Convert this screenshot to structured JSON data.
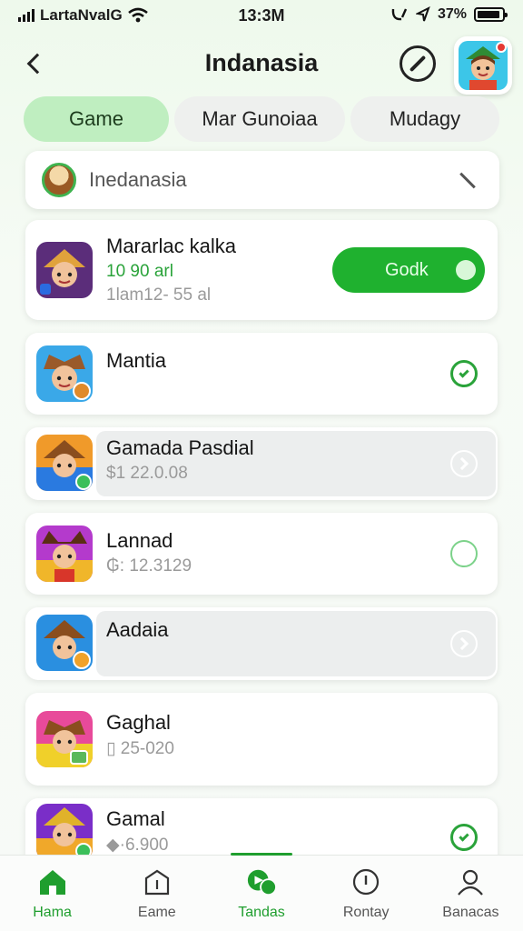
{
  "status_bar": {
    "carrier": "LartaNvalG",
    "time": "13:3M",
    "battery": "37%"
  },
  "header": {
    "title": "Indanasia"
  },
  "tabs": [
    {
      "label": "Game",
      "active": true
    },
    {
      "label": "Mar Gunoiaa",
      "active": false
    },
    {
      "label": "Mudagy",
      "active": false
    }
  ],
  "search": {
    "value": "Inedanasia"
  },
  "items": [
    {
      "name": "Mararlac kalka",
      "sub1": "10 90 arl",
      "sub2": "1lam12- 55 al",
      "toggle_label": "Godk"
    },
    {
      "name": "Mantia"
    },
    {
      "name": "Gamada Pasdial",
      "sub": "$1 22.0.08"
    },
    {
      "name": "Lannad",
      "sub": "12.3129",
      "sub_prefix": "₲:"
    },
    {
      "name": "Aadaia"
    },
    {
      "name": "Gaghal",
      "sub": "25-020"
    },
    {
      "name": "Gamal",
      "sub": "·6.900"
    }
  ],
  "bottom_nav": [
    {
      "label": "Hama",
      "icon": "home-icon",
      "active": true
    },
    {
      "label": "Eame",
      "icon": "box-icon",
      "active": false
    },
    {
      "label": "Tandas",
      "icon": "game-icon",
      "active": false,
      "indicator": true
    },
    {
      "label": "Rontay",
      "icon": "info-icon",
      "active": false
    },
    {
      "label": "Banacas",
      "icon": "profile-icon",
      "active": false
    }
  ],
  "colors": {
    "accent": "#1fb12f",
    "tab_active": "#bfeec0",
    "check": "#2aa33a"
  }
}
